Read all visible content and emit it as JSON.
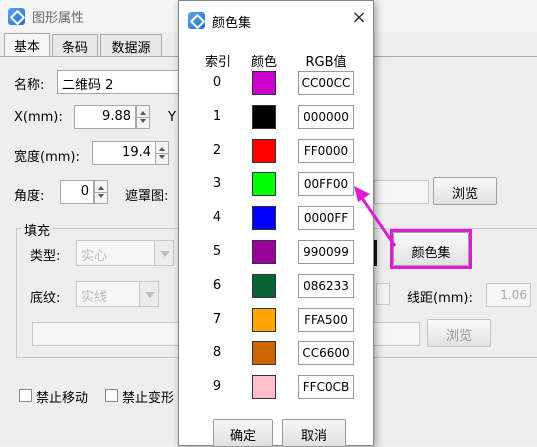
{
  "window": {
    "title": "图形属性",
    "tabs": [
      "基本",
      "条码",
      "数据源"
    ]
  },
  "form": {
    "name_label": "名称:",
    "name_value": "二维码 2",
    "x_label": "X(mm):",
    "x_value": "9.88",
    "y_label_partial": "Y",
    "width_label": "宽度(mm):",
    "width_value": "19.4",
    "angle_label": "角度:",
    "angle_value": "0",
    "mask_label": "遮罩图:",
    "browse_label": "浏览",
    "fill_group_label": "填充",
    "type_label": "类型:",
    "type_value": "实心",
    "pattern_label": "底纹:",
    "pattern_value": "实线",
    "color_set_button": "颜色集",
    "line_spacing_label": "线距(mm):",
    "line_spacing_value": "1.06",
    "browse2_label": "浏览",
    "lock_move_label": "禁止移动",
    "lock_transform_label": "禁止变形"
  },
  "color_popup": {
    "title": "颜色集",
    "close_glyph": "×",
    "header_index": "索引",
    "header_color": "颜色",
    "header_rgb": "RGB值",
    "colors": [
      {
        "index": "0",
        "hex": "CC00CC",
        "color": "#CC00CC"
      },
      {
        "index": "1",
        "hex": "000000",
        "color": "#000000"
      },
      {
        "index": "2",
        "hex": "FF0000",
        "color": "#FF0000"
      },
      {
        "index": "3",
        "hex": "00FF00",
        "color": "#00FF00"
      },
      {
        "index": "4",
        "hex": "0000FF",
        "color": "#0000FF"
      },
      {
        "index": "5",
        "hex": "990099",
        "color": "#990099"
      },
      {
        "index": "6",
        "hex": "086233",
        "color": "#086233"
      },
      {
        "index": "7",
        "hex": "FFA500",
        "color": "#FFA500"
      },
      {
        "index": "8",
        "hex": "CC6600",
        "color": "#CC6600"
      },
      {
        "index": "9",
        "hex": "FFC0CB",
        "color": "#FFC0CB"
      }
    ],
    "ok_label": "确定",
    "cancel_label": "取消"
  },
  "annotation": {
    "highlight_color": "#E01BD6"
  }
}
